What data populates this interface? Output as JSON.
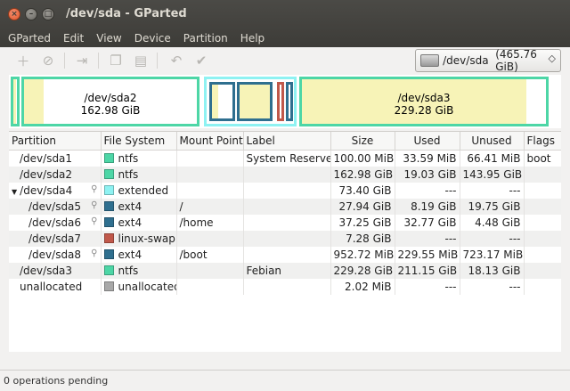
{
  "window": {
    "title": "/dev/sda - GParted"
  },
  "menu": [
    "GParted",
    "Edit",
    "View",
    "Device",
    "Partition",
    "Help"
  ],
  "device_selector": {
    "label": "/dev/sda",
    "size": "(465.76 GiB)"
  },
  "diskmap": {
    "sda2": {
      "name": "/dev/sda2",
      "size": "162.98 GiB"
    },
    "sda3": {
      "name": "/dev/sda3",
      "size": "229.28 GiB"
    }
  },
  "columns": [
    "Partition",
    "File System",
    "Mount Point",
    "Label",
    "Size",
    "Used",
    "Unused",
    "Flags"
  ],
  "rows": [
    {
      "partition": "/dev/sda1",
      "fs": "ntfs",
      "mount": "",
      "label": "System Reserved",
      "size": "100.00 MiB",
      "used": "33.59 MiB",
      "unused": "66.41 MiB",
      "flags": "boot"
    },
    {
      "partition": "/dev/sda2",
      "fs": "ntfs",
      "mount": "",
      "label": "",
      "size": "162.98 GiB",
      "used": "19.03 GiB",
      "unused": "143.95 GiB",
      "flags": ""
    },
    {
      "partition": "/dev/sda4",
      "fs": "extended",
      "mount": "",
      "label": "",
      "size": "73.40 GiB",
      "used": "---",
      "unused": "---",
      "flags": ""
    },
    {
      "partition": "/dev/sda5",
      "fs": "ext4",
      "mount": "/",
      "label": "",
      "size": "27.94 GiB",
      "used": "8.19 GiB",
      "unused": "19.75 GiB",
      "flags": ""
    },
    {
      "partition": "/dev/sda6",
      "fs": "ext4",
      "mount": "/home",
      "label": "",
      "size": "37.25 GiB",
      "used": "32.77 GiB",
      "unused": "4.48 GiB",
      "flags": ""
    },
    {
      "partition": "/dev/sda7",
      "fs": "linux-swap",
      "mount": "",
      "label": "",
      "size": "7.28 GiB",
      "used": "---",
      "unused": "---",
      "flags": ""
    },
    {
      "partition": "/dev/sda8",
      "fs": "ext4",
      "mount": "/boot",
      "label": "",
      "size": "952.72 MiB",
      "used": "229.55 MiB",
      "unused": "723.17 MiB",
      "flags": ""
    },
    {
      "partition": "/dev/sda3",
      "fs": "ntfs",
      "mount": "",
      "label": "Febian",
      "size": "229.28 GiB",
      "used": "211.15 GiB",
      "unused": "18.13 GiB",
      "flags": ""
    },
    {
      "partition": "unallocated",
      "fs": "unallocated",
      "mount": "",
      "label": "",
      "size": "2.02 MiB",
      "used": "---",
      "unused": "---",
      "flags": ""
    }
  ],
  "colors": {
    "ntfs": "#4dd6a6",
    "extended": "#8ef2f2",
    "ext4": "#2f6f8f",
    "linux-swap": "#c0584a",
    "unallocated": "#a8a8a8",
    "used": "#f7f3b7"
  },
  "status": "0 operations pending"
}
